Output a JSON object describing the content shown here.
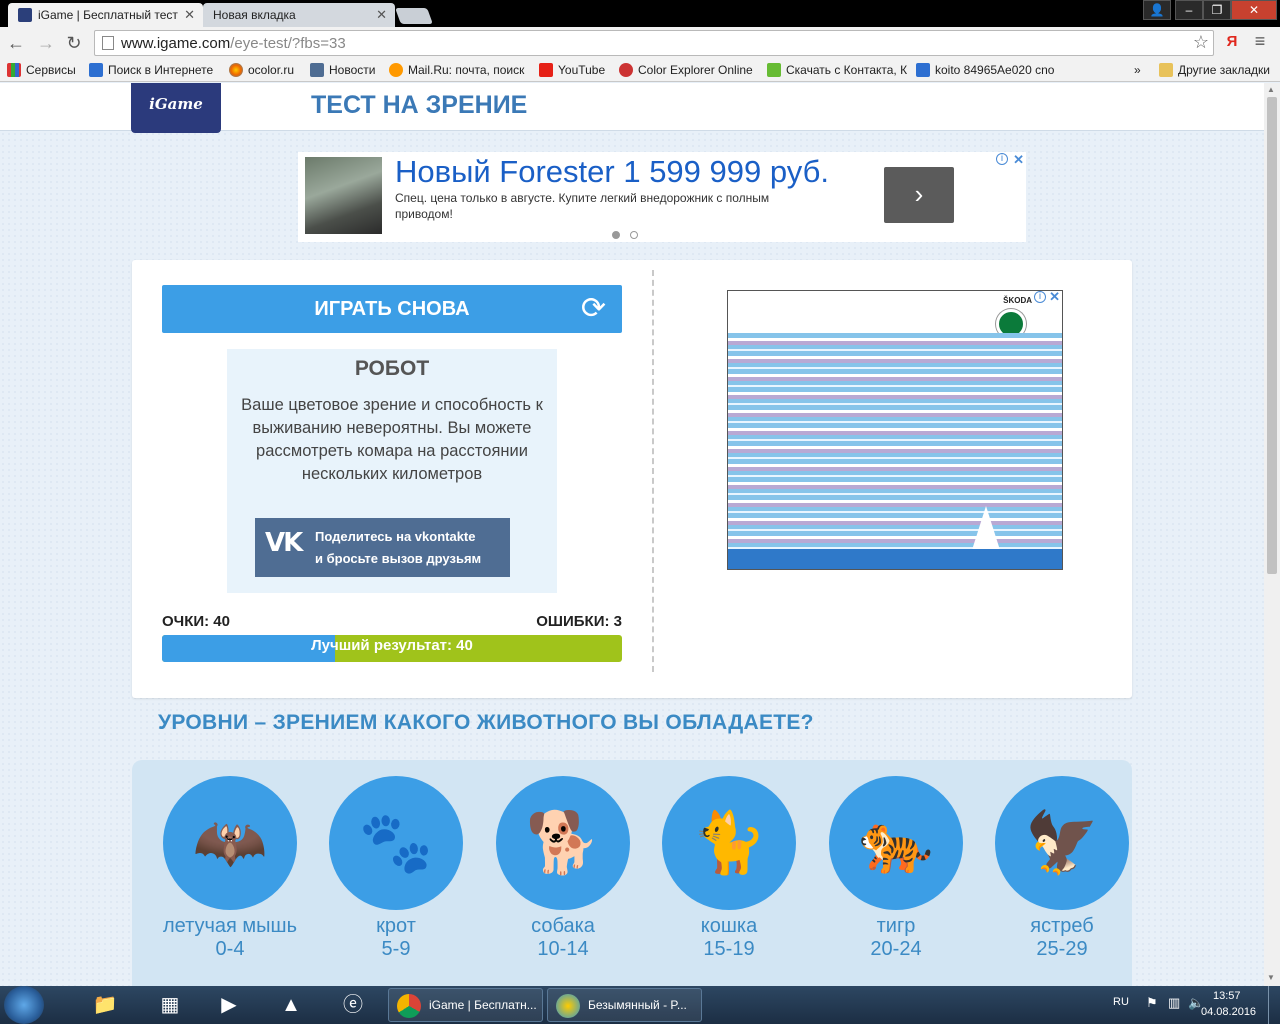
{
  "browser": {
    "tabs": [
      {
        "title": "iGame | Бесплатный тест",
        "active": true
      },
      {
        "title": "Новая вкладка",
        "active": false
      }
    ],
    "url_host": "www.igame.com",
    "url_path": "/eye-test/?fbs=33",
    "yandex_label": "Я",
    "bookmarks": [
      {
        "label": "Сервисы",
        "icon": "apps-grid-icon"
      },
      {
        "label": "Поиск в Интернете",
        "icon": "search-icon"
      },
      {
        "label": "ocolor.ru",
        "icon": "ocolor-icon"
      },
      {
        "label": "Новости",
        "icon": "vk-icon"
      },
      {
        "label": "Mail.Ru: почта, поиск",
        "icon": "mailru-icon"
      },
      {
        "label": "YouTube",
        "icon": "youtube-icon"
      },
      {
        "label": "Color Explorer Online",
        "icon": "color-explorer-icon"
      },
      {
        "label": "Скачать с Контакта, К",
        "icon": "download-icon"
      },
      {
        "label": "koito 84965Ae020 cno",
        "icon": "search-icon"
      }
    ],
    "bookmarks_overflow": "»",
    "other_bookmarks": "Другие закладки"
  },
  "site": {
    "logo": "iGame",
    "title": "ТЕСТ НА ЗРЕНИЕ"
  },
  "ad_top": {
    "headline": "Новый Forester 1 599 999 руб.",
    "text": "Спец. цена только в августе. Купите легкий внедорожник с полным приводом!",
    "arrow": "›"
  },
  "ad_right": {
    "brand": "ŠKODA"
  },
  "result": {
    "play_again": "ИГРАТЬ СНОВА",
    "title": "РОБОТ",
    "description": "Ваше цветовое зрение и способность к выживанию невероятны. Вы можете рассмотреть комара на расстоянии нескольких километров",
    "share_line1": "Поделитесь на vkontakte",
    "share_line2": "и бросьте вызов друзьям",
    "vk_logo": "VK",
    "score_label": "ОЧКИ: 40",
    "errors_label": "ОШИБКИ: 3",
    "best_result": "Лучший результат: 40",
    "progress_fraction": 0.375
  },
  "levels": {
    "heading": "УРОВНИ – ЗРЕНИЕМ КАКОГО ЖИВОТНОГО ВЫ ОБЛАДАЕТЕ?",
    "items": [
      {
        "name": "летучая мышь",
        "range": "0-4",
        "icon": "bat-icon",
        "glyph": "🦇"
      },
      {
        "name": "крот",
        "range": "5-9",
        "icon": "mole-icon",
        "glyph": "🐾"
      },
      {
        "name": "собака",
        "range": "10-14",
        "icon": "dog-icon",
        "glyph": "🐕"
      },
      {
        "name": "кошка",
        "range": "15-19",
        "icon": "cat-icon",
        "glyph": "🐈"
      },
      {
        "name": "тигр",
        "range": "20-24",
        "icon": "tiger-icon",
        "glyph": "🐅"
      },
      {
        "name": "ястреб",
        "range": "25-29",
        "icon": "hawk-icon",
        "glyph": "🦅"
      }
    ]
  },
  "taskbar": {
    "tasks": [
      {
        "title": "iGame | Бесплатн..."
      },
      {
        "title": "Безымянный - P..."
      }
    ],
    "lang": "RU",
    "time": "13:57",
    "date": "04.08.2016"
  },
  "colors": {
    "accent_blue": "#3c9ee6",
    "progress_green": "#a0c31b",
    "heading_blue": "#3b8ac4",
    "vk_blue": "#4f6d93"
  }
}
